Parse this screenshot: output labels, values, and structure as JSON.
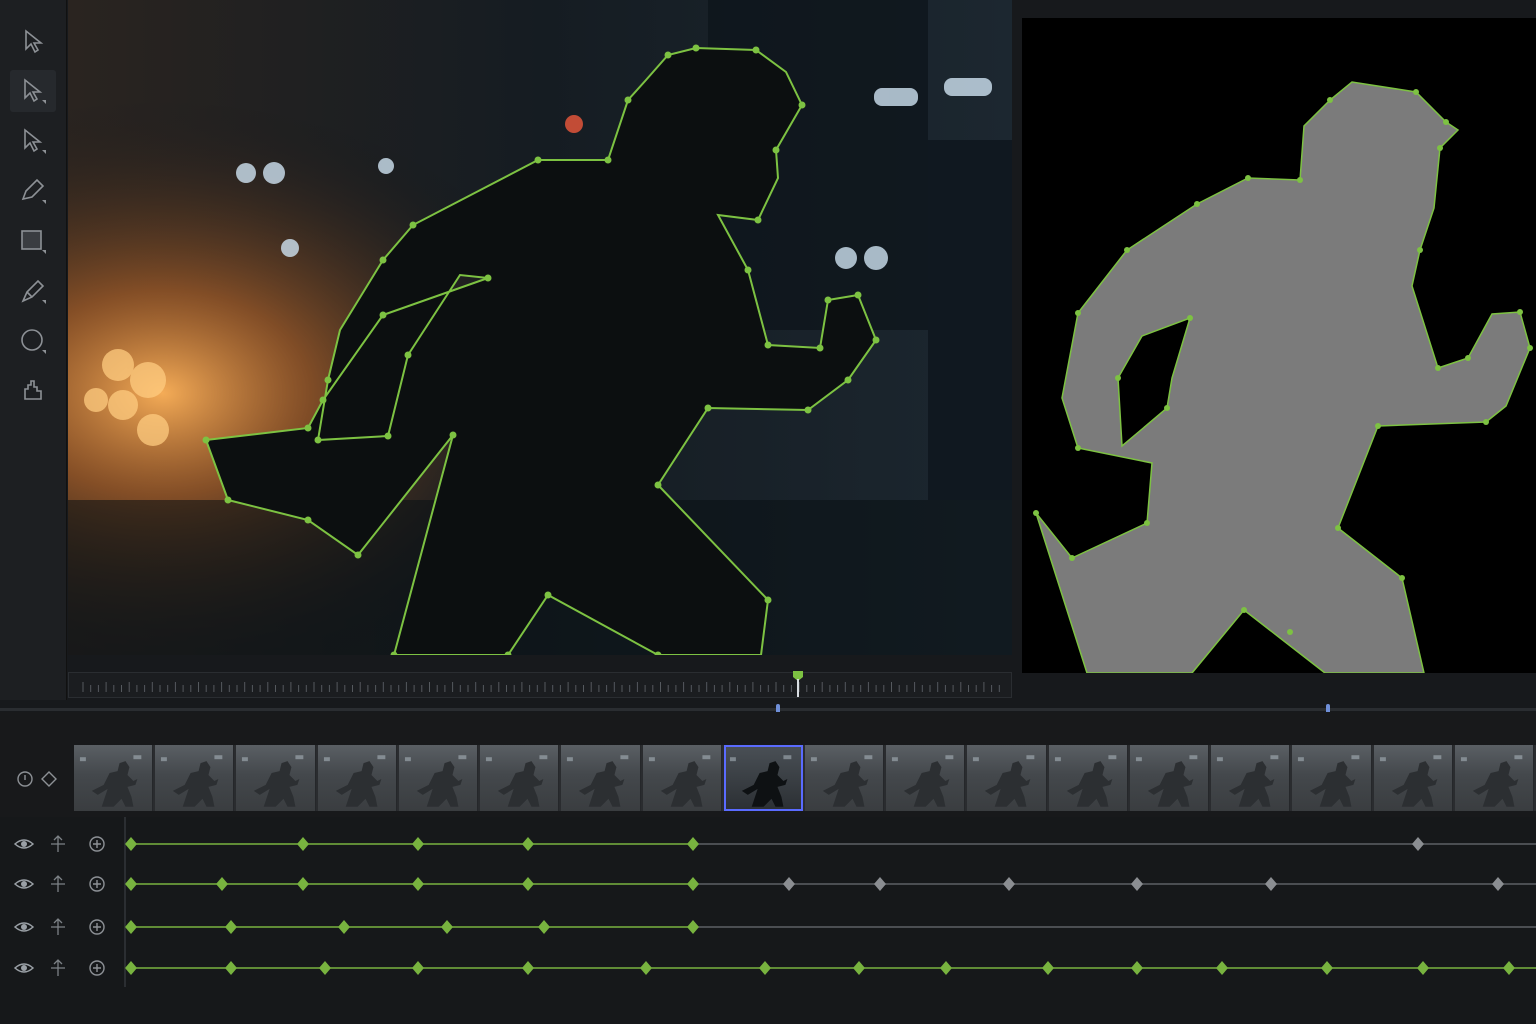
{
  "toolbar": {
    "tools": [
      {
        "name": "select-arrow-icon",
        "active": false
      },
      {
        "name": "direct-select-icon",
        "active": true
      },
      {
        "name": "point-select-icon",
        "active": false
      },
      {
        "name": "pen-icon",
        "active": false
      },
      {
        "name": "rectangle-mask-icon",
        "active": false
      },
      {
        "name": "brush-icon",
        "active": false
      },
      {
        "name": "ellipse-mask-icon",
        "active": false
      },
      {
        "name": "hand-icon",
        "active": false
      }
    ]
  },
  "colors": {
    "accent": "#7dc242",
    "keyframe_active": "#78b33f",
    "keyframe_inactive": "#8b8e92",
    "selected_frame": "#5a6bff"
  },
  "timeline": {
    "frame_count": 18,
    "selected_frame": 8,
    "playhead_fraction": 0.773
  },
  "tracks": [
    {
      "name": "track-1",
      "keys": [
        131,
        303,
        418,
        528,
        693
      ],
      "inactive_keys": [
        1418
      ],
      "active_until": 693
    },
    {
      "name": "track-2",
      "keys": [
        131,
        222,
        303,
        418,
        528,
        693
      ],
      "inactive_keys": [
        789,
        880,
        1009,
        1137,
        1271,
        1498
      ],
      "active_until": 693
    },
    {
      "name": "track-3",
      "keys": [
        131,
        231,
        344,
        447,
        544,
        693
      ],
      "inactive_keys": [],
      "active_until": 693
    },
    {
      "name": "track-4",
      "keys": [
        131,
        231,
        325,
        418,
        528,
        646,
        765,
        859,
        946,
        1048,
        1137,
        1222,
        1327,
        1423,
        1509
      ],
      "inactive_keys": [],
      "active_until": 1536
    }
  ]
}
